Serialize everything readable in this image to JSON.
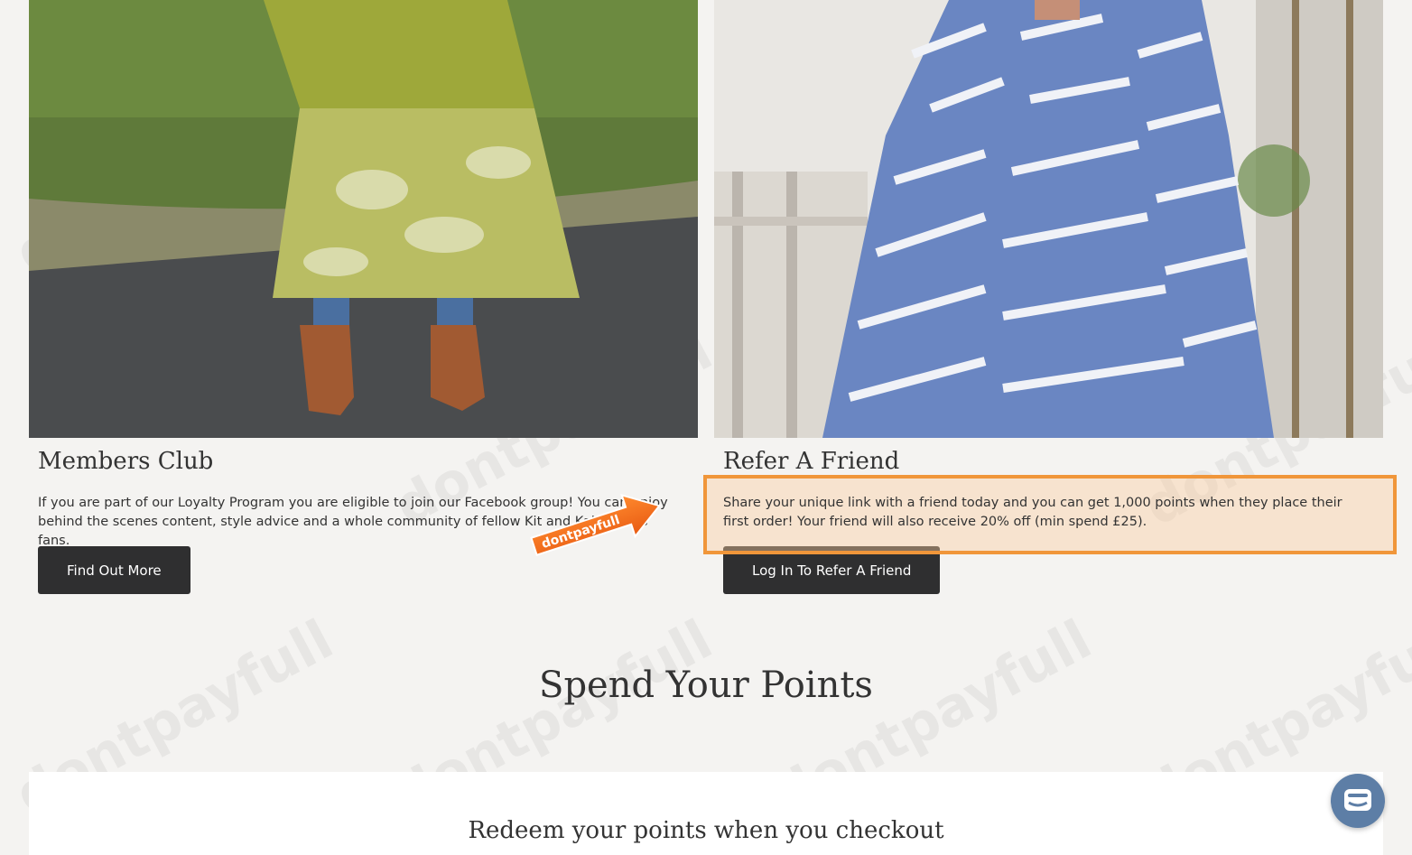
{
  "members_club": {
    "title": "Members Club",
    "text": "If you are part of our Loyalty Program you are eligible to join our Facebook group! You can enjoy behind the scenes content, style advice and a whole community of fellow Kit and Kaboodlers fans.",
    "button_label": "Find Out More"
  },
  "refer_friend": {
    "title": "Refer A Friend",
    "text": "Share your unique link with a friend today and you can get 1,000 points when they place their first order! Your friend will also receive 20% off (min spend £25).",
    "button_label": "Log In To Refer A Friend"
  },
  "spend_points": {
    "title": "Spend Your Points",
    "subtitle": "Redeem your points when you checkout"
  },
  "watermark_text": "dontpayfull",
  "badge_text": "dontpayfull",
  "chat_icon": "chat-bubble-icon",
  "colors": {
    "background": "#f4f3f1",
    "button": "#2f2f30",
    "highlight": "#f0963a",
    "chat": "#5d7ea6"
  }
}
